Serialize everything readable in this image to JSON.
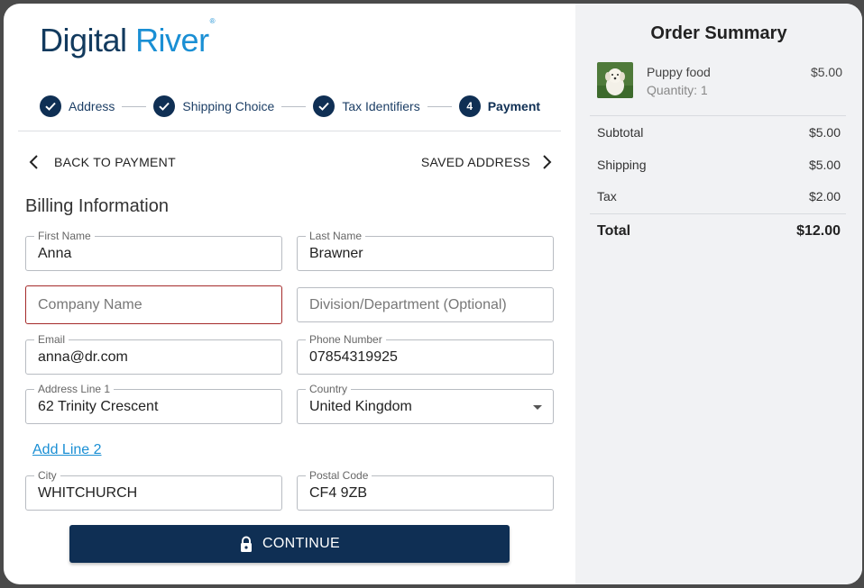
{
  "logo": {
    "word1": "Digital",
    "word2": "River",
    "mark": "®"
  },
  "stepper": {
    "steps": [
      {
        "label": "Address",
        "state": "complete",
        "icon": "check-icon"
      },
      {
        "label": "Shipping Choice",
        "state": "complete",
        "icon": "check-icon"
      },
      {
        "label": "Tax Identifiers",
        "state": "complete",
        "icon": "check-icon"
      },
      {
        "label": "Payment",
        "state": "active",
        "number": "4"
      }
    ]
  },
  "nav": {
    "back_label": "BACK TO PAYMENT",
    "next_label": "SAVED ADDRESS"
  },
  "billing": {
    "title": "Billing Information",
    "first_name": {
      "label": "First Name",
      "value": "Anna"
    },
    "last_name": {
      "label": "Last Name",
      "value": "Brawner"
    },
    "company": {
      "placeholder": "Company Name"
    },
    "division": {
      "placeholder": "Division/Department (Optional)"
    },
    "email": {
      "label": "Email",
      "value": "anna@dr.com"
    },
    "phone": {
      "label": "Phone Number",
      "value": "07854319925"
    },
    "address1": {
      "label": "Address Line 1",
      "value": "62 Trinity Crescent"
    },
    "country": {
      "label": "Country",
      "value": "United Kingdom"
    },
    "add_line_2": "Add Line 2",
    "city": {
      "label": "City",
      "value": "WHITCHURCH"
    },
    "postal": {
      "label": "Postal Code",
      "value": "CF4 9ZB"
    }
  },
  "continue_label": "CONTINUE",
  "summary": {
    "title": "Order Summary",
    "item": {
      "name": "Puppy food",
      "quantity": "Quantity: 1",
      "price": "$5.00"
    },
    "subtotal": {
      "label": "Subtotal",
      "value": "$5.00"
    },
    "shipping": {
      "label": "Shipping",
      "value": "$5.00"
    },
    "tax": {
      "label": "Tax",
      "value": "$2.00"
    },
    "total": {
      "label": "Total",
      "value": "$12.00"
    }
  },
  "colors": {
    "primary": "#0f2f54",
    "accent": "#1a8fd4",
    "error": "#a52a2a"
  }
}
